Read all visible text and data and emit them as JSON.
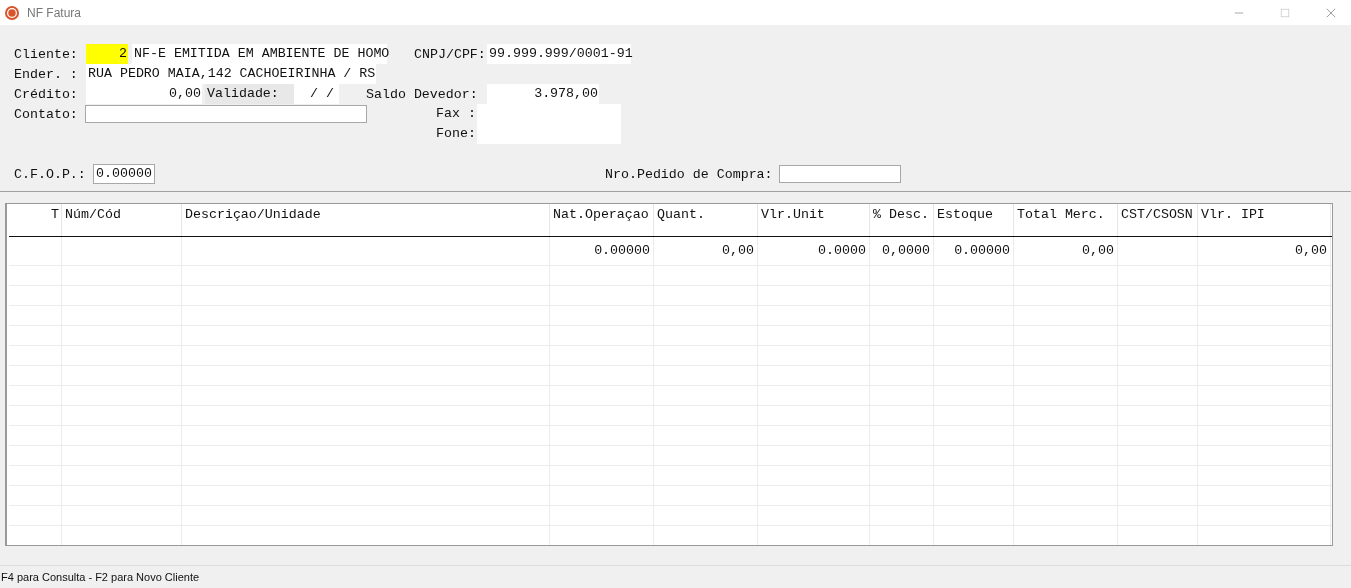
{
  "window": {
    "title": "NF Fatura"
  },
  "form": {
    "cliente_label": "Cliente:",
    "cliente_code": "2",
    "cliente_name": "NF-E EMITIDA EM AMBIENTE DE HOMO",
    "cnpj_label": "CNPJ/CPF:",
    "cnpj": "99.999.999/0001-91",
    "ender_label": "Ender. :",
    "ender": "RUA PEDRO MAIA,142 CACHOEIRINHA / RS",
    "credito_label": "Crédito:",
    "credito": "0,00",
    "validade_label": "Validade:",
    "validade": "/  /",
    "saldo_label": "Saldo Devedor:",
    "saldo": "3.978,00",
    "contato_label": "Contato:",
    "fax_label": "Fax :",
    "fone_label": "Fone:",
    "cfop_label": "C.F.O.P.:",
    "cfop": "0.00000",
    "pedido_label": "Nro.Pedido de Compra:"
  },
  "table": {
    "columns": [
      "T",
      "Núm/Cód",
      "Descriçao/Unidade",
      "Nat.Operaçao",
      "Quant.",
      "Vlr.Unit",
      "% Desc.",
      "Estoque",
      "Total Merc.",
      "CST/CSOSN",
      "Vlr. IPI"
    ],
    "rows": [
      [
        "",
        "",
        "",
        "0.00000",
        "0,00",
        "0.0000",
        "0,0000",
        "0.00000",
        "0,00",
        "",
        "0,00"
      ]
    ]
  },
  "status_bar": "F4 para Consulta - F2 para Novo Cliente"
}
